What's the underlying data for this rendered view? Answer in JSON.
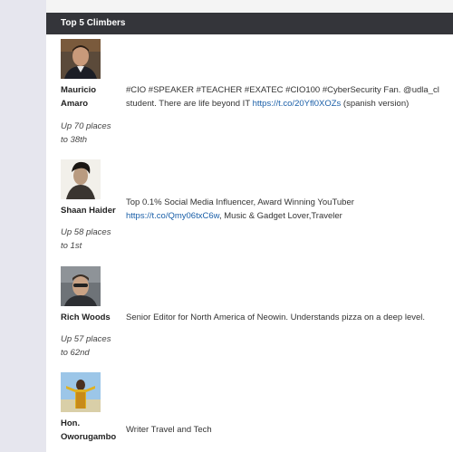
{
  "widget": {
    "title": "Top 5 Climbers"
  },
  "climbers": [
    {
      "name_line1": "Mauricio",
      "name_line2": "Amaro",
      "bio_line1": "#CIO #SPEAKER #TEACHER #EXATEC #CIO100 #CyberSecurity Fan. @udla_cl",
      "bio_line2_pre": "student. There are life beyond IT ",
      "bio_link": "https://t.co/20Yfl0XOZs",
      "bio_line2_post": " (spanish version)",
      "rank_line1": "Up 70 places",
      "rank_line2": "to 38th",
      "avatar_icon": "person-photo"
    },
    {
      "name_line1": "Shaan Haider",
      "bio_line1": "Top 0.1% Social Media Influencer, Award Winning YouTuber",
      "bio_link": "https://t.co/Qmy06txC6w",
      "bio_line2_post": ", Music & Gadget Lover,Traveler",
      "rank_line1": "Up 58 places",
      "rank_line2": "to 1st",
      "avatar_icon": "person-photo"
    },
    {
      "name_line1": "Rich Woods",
      "bio_line1": "Senior Editor for North America of Neowin. Understands pizza on a deep level.",
      "rank_line1": "Up 57 places",
      "rank_line2": "to 62nd",
      "avatar_icon": "person-photo"
    },
    {
      "name_line1": "Hon.",
      "name_line2": "Oworugambo",
      "bio_line1": "Writer Travel and Tech",
      "avatar_icon": "person-photo"
    }
  ]
}
